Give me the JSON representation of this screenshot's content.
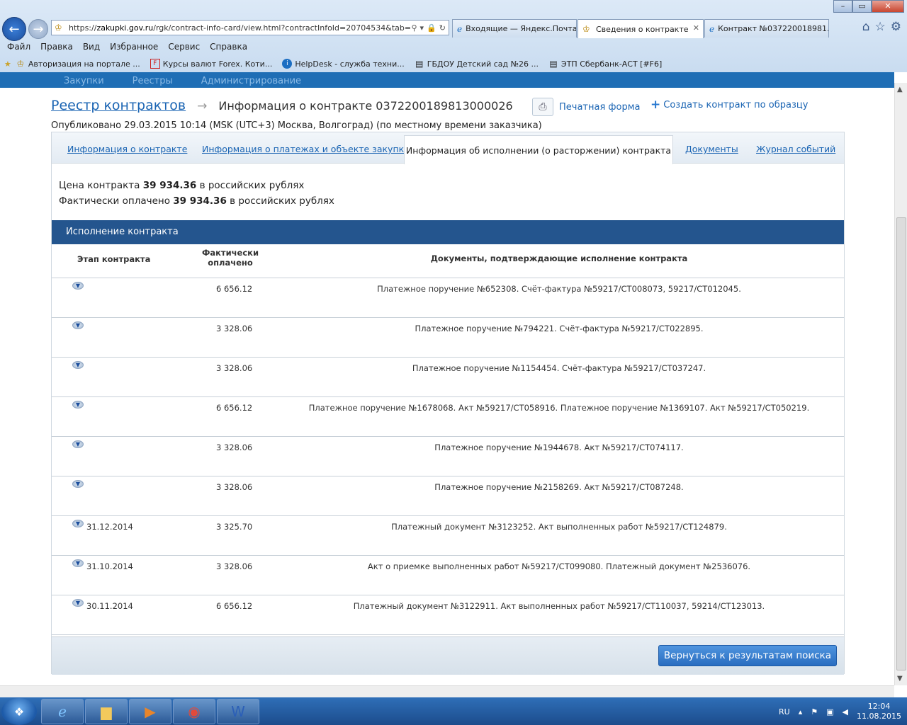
{
  "browser": {
    "url_prefix": "https://",
    "url_domain": "zakupki.gov.ru",
    "url_path": "/rgk/contract-info-card/view.html?contractInfoId=20704534&tab=",
    "tabs": [
      {
        "label": "Входящие — Яндекс.Почта"
      },
      {
        "label": "Сведения о контракте"
      },
      {
        "label": "Контракт №037220018981..."
      }
    ],
    "menu": [
      "Файл",
      "Правка",
      "Вид",
      "Избранное",
      "Сервис",
      "Справка"
    ],
    "favorites": [
      "Авторизация на портале ...",
      "Курсы валют Forex. Коти...",
      "HelpDesk - служба техни...",
      "ГБДОУ Детский сад №26 ...",
      "ЭТП Сбербанк-АСТ [#F6]"
    ]
  },
  "site_nav": [
    "Закупки",
    "Реестры",
    "Администрирование"
  ],
  "header": {
    "breadcrumb_link": "Реестр контрактов",
    "breadcrumb_current": "Информация о контракте 0372200189813000026",
    "published": "Опубликовано 29.03.2015 10:14 (MSK (UTC+3) Москва, Волгоград) (по местному времени заказчика)",
    "print_label": "Печатная форма",
    "create_label": "Создать контракт по образцу"
  },
  "panel_tabs": {
    "info": "Информация о контракте",
    "payments": "Информация о платежах и объекте закупки",
    "execution": "Информация об исполнении (о расторжении) контракта",
    "documents": "Документы",
    "journal": "Журнал событий"
  },
  "summary": {
    "price_prefix": "Цена контракта",
    "price_value": "39 934.36",
    "price_suffix": "в российских рублях",
    "paid_prefix": "Фактически оплачено",
    "paid_value": "39 934.36",
    "paid_suffix": "в российских рублях"
  },
  "section_title": "Исполнение контракта",
  "table": {
    "headers": {
      "stage": "Этап контракта",
      "paid_line1": "Фактически",
      "paid_line2": "оплачено",
      "docs": "Документы, подтверждающие исполнение контракта"
    },
    "rows": [
      {
        "date": "",
        "paid": "6 656.12",
        "docs": "Платежное поручение №652308. Счёт-фактура №59217/СТ008073, 59217/СТ012045."
      },
      {
        "date": "",
        "paid": "3 328.06",
        "docs": "Платежное поручение №794221. Счёт-фактура №59217/СТ022895."
      },
      {
        "date": "",
        "paid": "3 328.06",
        "docs": "Платежное поручение №1154454. Счёт-фактура №59217/СТ037247."
      },
      {
        "date": "",
        "paid": "6 656.12",
        "docs": "Платежное поручение №1678068. Акт №59217/СТ058916. Платежное поручение №1369107. Акт №59217/СТ050219."
      },
      {
        "date": "",
        "paid": "3 328.06",
        "docs": "Платежное поручение №1944678. Акт №59217/СТ074117."
      },
      {
        "date": "",
        "paid": "3 328.06",
        "docs": "Платежное поручение №2158269. Акт №59217/СТ087248."
      },
      {
        "date": "31.12.2014",
        "paid": "3 325.70",
        "docs": "Платежный документ №3123252. Акт выполненных работ №59217/СТ124879."
      },
      {
        "date": "31.10.2014",
        "paid": "3 328.06",
        "docs": "Акт о приемке выполненных работ №59217/СТ099080. Платежный документ №2536076."
      },
      {
        "date": "30.11.2014",
        "paid": "6 656.12",
        "docs": "Платежный документ №3122911. Акт выполненных работ №59217/СТ110037, 59214/СТ123013."
      }
    ]
  },
  "return_label": "Вернуться к результатам поиска",
  "taskbar": {
    "lang": "RU",
    "time": "12:04",
    "date": "11.08.2015"
  },
  "colors": {
    "accent": "#1a64b3",
    "section_header": "#24558e",
    "site_nav": "#1f6eb5"
  }
}
